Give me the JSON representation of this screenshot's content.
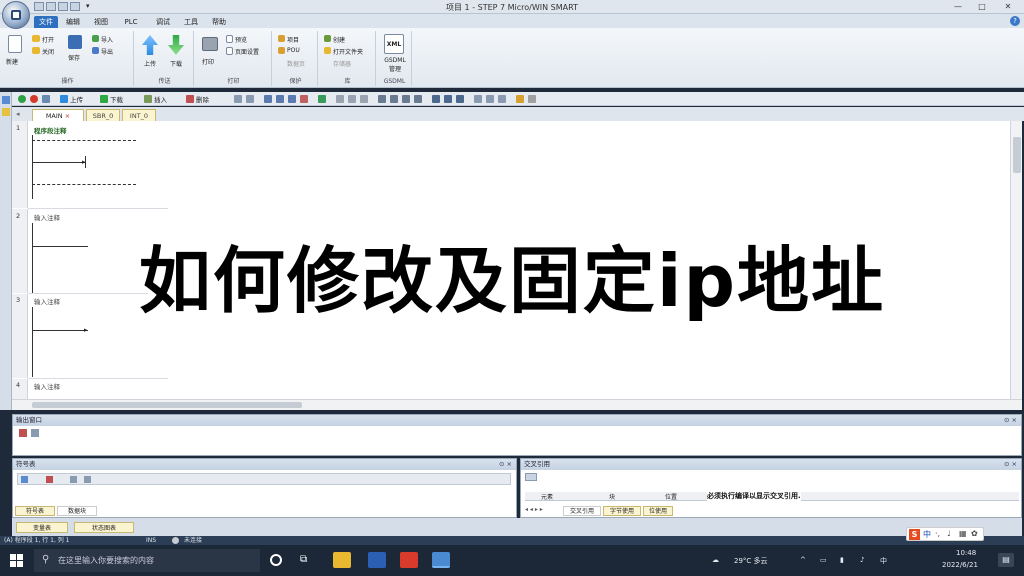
{
  "window": {
    "title": "项目 1 - STEP 7 Micro/WIN SMART",
    "min_label": "—",
    "max_label": "□",
    "close_label": "✕"
  },
  "ribbon_tabs": [
    "文件",
    "编辑",
    "视图",
    "PLC",
    "调试",
    "工具",
    "帮助"
  ],
  "ribbon": {
    "groups": {
      "operation": "操作",
      "transfer": "传送",
      "print": "打印",
      "protect": "保护",
      "library": "库",
      "gsdml": "GSDML"
    },
    "new_label": "新建",
    "open_label": "打开",
    "close_label": "关闭",
    "save_label": "保存",
    "import_label": "导入",
    "export_label": "导出",
    "upload_label": "上传",
    "download_label": "下载",
    "print_label": "打印",
    "preview_label": "预览",
    "page_setup_label": "页面设置",
    "project_label": "项目",
    "pou_label": "POU",
    "data_page_label": "数据页",
    "library_label": "创建",
    "open_lib_folder_label": "打开文件夹",
    "memory_label": "存储器",
    "xml_label": "XML",
    "gsdml_manage_label": "GSDML\n管理"
  },
  "toolbar": {
    "upload_label": "上传",
    "download_label": "下载",
    "insert_label": "插入",
    "delete_label": "删除"
  },
  "doc_tabs": [
    "MAIN",
    "SBR_0",
    "INT_0"
  ],
  "editor": {
    "rungs": [
      {
        "num": "1",
        "comment": "程序段注释"
      },
      {
        "num": "2",
        "comment": "输入注释"
      },
      {
        "num": "3",
        "comment": "输入注释"
      },
      {
        "num": "4",
        "comment": "输入注释"
      }
    ]
  },
  "overlay_title": "如何修改及固定ip地址",
  "panels": {
    "output_title": "输出窗口",
    "symbol_title": "符号表",
    "xref_title": "交叉引用",
    "xref_col_element": "元素",
    "xref_col_block": "块",
    "xref_col_location": "位置",
    "xref_message": "必须执行编译以显示交叉引用.",
    "xref_tabs": [
      "交叉引用",
      "字节使用",
      "位使用"
    ],
    "symbol_tabs": [
      "符号表",
      "数据块"
    ],
    "bottom_tabs": [
      "变量表",
      "状态图表"
    ],
    "pin_label": "⊙ ×"
  },
  "statusbar": {
    "position": "(A) 程序段 1, 行 1, 列 1",
    "mode": "INS",
    "connection": "未连接"
  },
  "taskbar": {
    "search_placeholder": "在这里输入你要搜索的内容",
    "weather": "29°C 多云",
    "time": "10:48",
    "date": "2022/6/21",
    "lang": "中"
  },
  "colors": {
    "ribbon_active_tab": "#2e6fc0",
    "doc_tab_bg": "#fbf4d0",
    "green_run": "#2ea043",
    "red_stop": "#d33a2c",
    "upload_blue": "#2e8be0",
    "download_green": "#2ea843"
  }
}
